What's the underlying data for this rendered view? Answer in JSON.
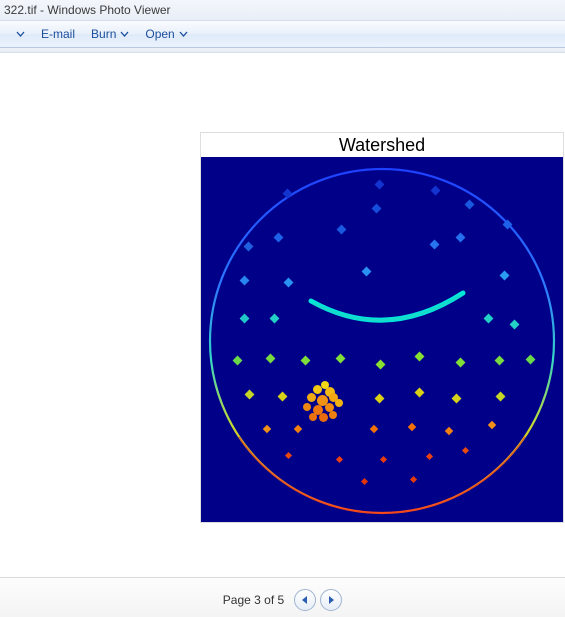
{
  "title": "322.tif - Windows Photo Viewer",
  "toolbar": {
    "email_label": "E-mail",
    "burn_label": "Burn",
    "open_label": "Open"
  },
  "image": {
    "title": "Watershed",
    "bg_color": "#000088"
  },
  "footer": {
    "page_text": "Page 3 of 5"
  }
}
